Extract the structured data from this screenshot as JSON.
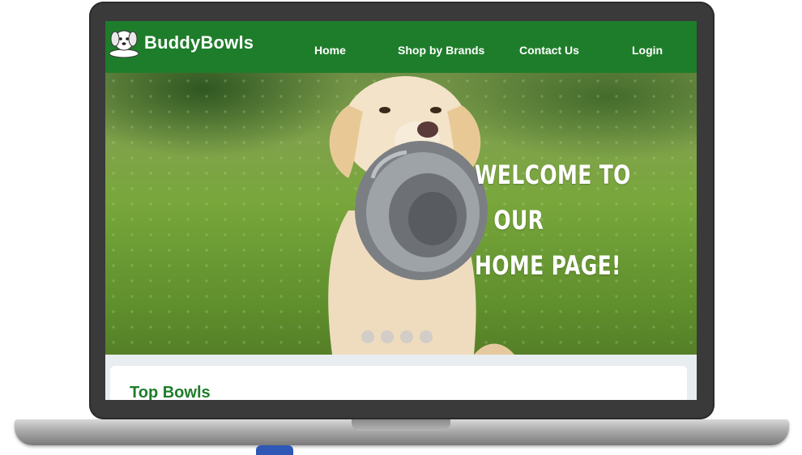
{
  "brand": {
    "name": "BuddyBowls",
    "logo_icon": "dog-logo-icon"
  },
  "nav": {
    "items": [
      {
        "label": "Home"
      },
      {
        "label": "Shop by Brands"
      },
      {
        "label": "Contact Us"
      },
      {
        "label": "Login"
      }
    ]
  },
  "hero": {
    "line1": "WELCOME TO",
    "line2": "OUR",
    "line3": "HOME PAGE!",
    "slide_count": 4,
    "image_icon": "golden-retriever-with-bowl-photo"
  },
  "section": {
    "title": "Top Bowls"
  },
  "colors": {
    "brand_green": "#1e7d2a",
    "white": "#ffffff",
    "laptop_frame": "#3a3a3a"
  }
}
